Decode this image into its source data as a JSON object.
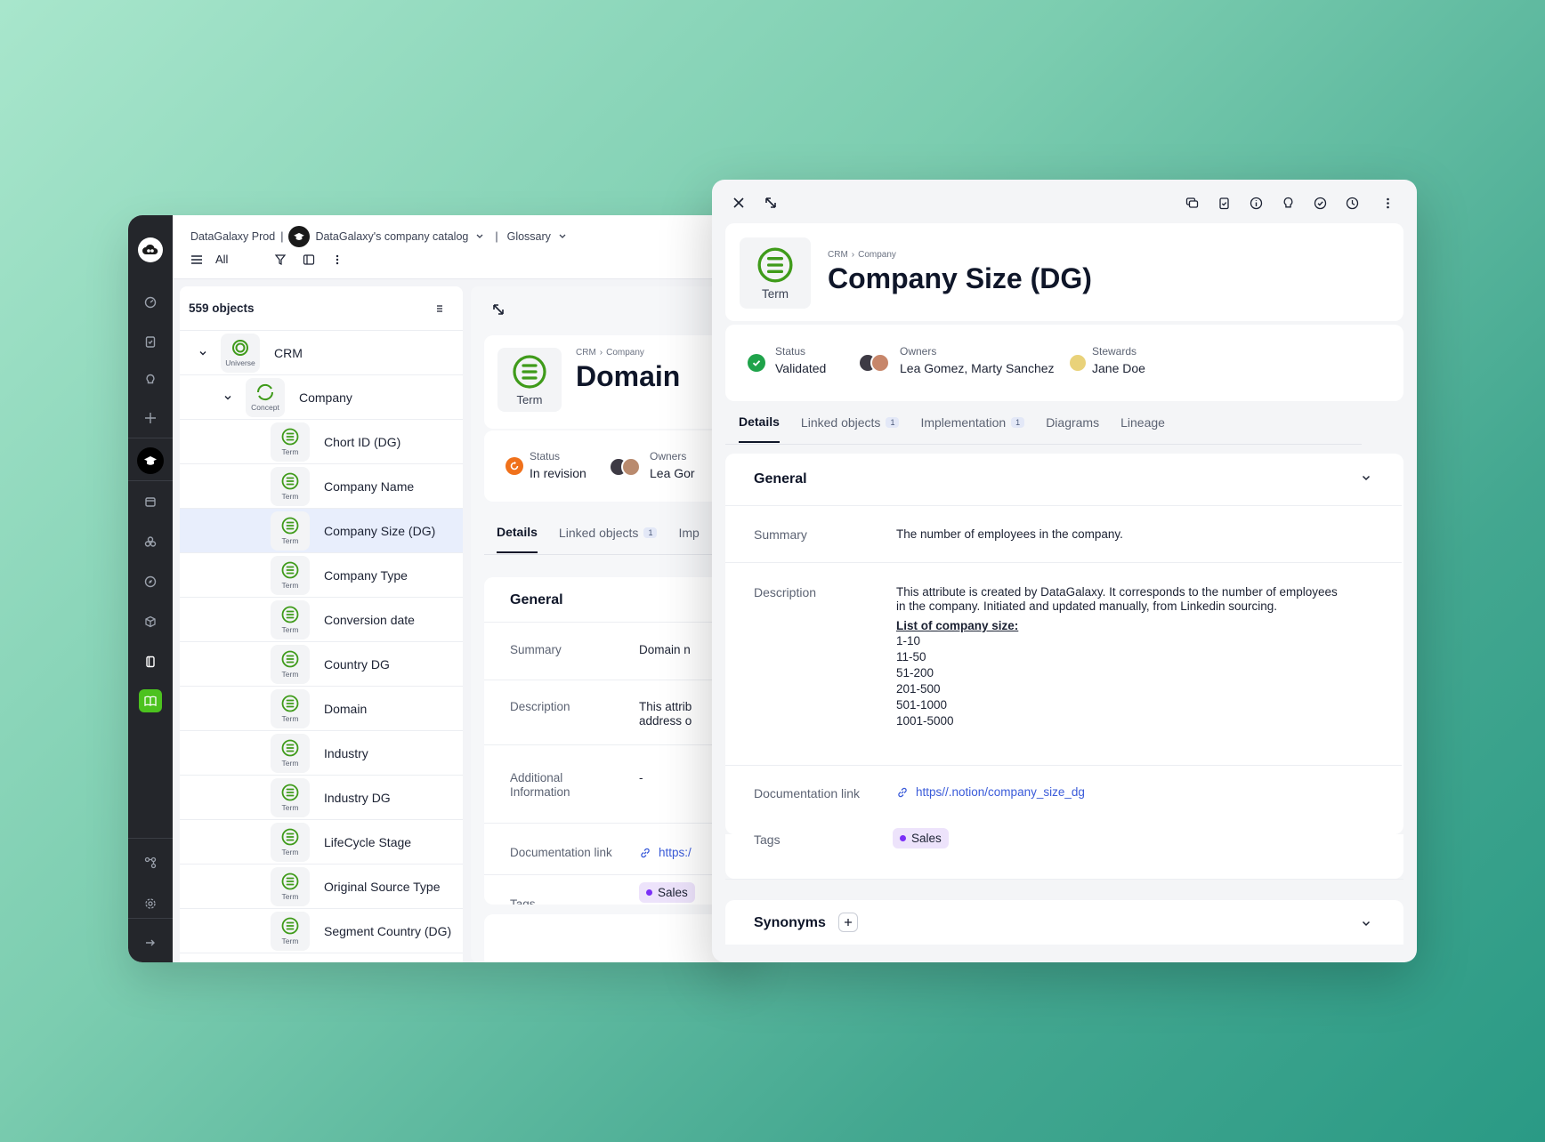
{
  "colors": {
    "accent_green": "#3f9b1a",
    "brand_dark": "#24262b",
    "link_blue": "#3a5bd9",
    "tag_purple": "#7b2ff7",
    "status_orange": "#f0711b",
    "status_green": "#1fa34a"
  },
  "back": {
    "topbar": {
      "workspace": "DataGalaxy Prod",
      "separator": "|",
      "catalog": "DataGalaxy's company catalog",
      "module": "Glossary",
      "filter_all": "All"
    },
    "list": {
      "count_label": "559 objects",
      "universe": {
        "label": "CRM",
        "type": "Universe"
      },
      "concept": {
        "label": "Company",
        "type": "Concept"
      },
      "term_caption": "Term",
      "terms": [
        "Chort ID (DG)",
        "Company Name",
        "Company Size (DG)",
        "Company Type",
        "Conversion date",
        "Country DG",
        "Domain",
        "Industry",
        "Industry DG",
        "LifeCycle Stage",
        "Original Source Type",
        "Segment Country (DG)"
      ]
    },
    "detail": {
      "crumb_1": "CRM",
      "crumb_2": "Company",
      "title": "Domain",
      "type": "Term",
      "status_label": "Status",
      "status_value": "In revision",
      "owners_label": "Owners",
      "owners_value": "Lea Gor",
      "tabs": [
        {
          "label": "Details",
          "count": ""
        },
        {
          "label": "Linked objects",
          "count": "1"
        },
        {
          "label": "Imp",
          "count": ""
        }
      ],
      "general": "General",
      "summary_label": "Summary",
      "summary_value": "Domain n",
      "description_label": "Description",
      "description_value_1": "This attrib",
      "description_value_2": "address o",
      "additional_label_1": "Additional",
      "additional_label_2": "Information",
      "additional_value": "-",
      "doc_label": "Documentation link",
      "doc_value": "https:/",
      "tags_label": "Tags",
      "tag": "Sales"
    }
  },
  "front": {
    "crumb_1": "CRM",
    "crumb_2": "Company",
    "title": "Company Size (DG)",
    "type": "Term",
    "status_label": "Status",
    "status_value": "Validated",
    "owners_label": "Owners",
    "owners_value": "Lea Gomez, Marty Sanchez",
    "stewards_label": "Stewards",
    "stewards_value": "Jane Doe",
    "tabs": [
      {
        "label": "Details",
        "count": ""
      },
      {
        "label": "Linked objects",
        "count": "1"
      },
      {
        "label": "Implementation",
        "count": "1"
      },
      {
        "label": "Diagrams",
        "count": ""
      },
      {
        "label": "Lineage",
        "count": ""
      }
    ],
    "general": {
      "title": "General",
      "summary_label": "Summary",
      "summary_value": "The number of employees in the company.",
      "description_label": "Description",
      "description_line_1": "This attribute is created by DataGalaxy. It corresponds to the number of employees",
      "description_line_2": "in the company. Initiated and updated manually, from Linkedin sourcing.",
      "list_title": "List of company size:",
      "sizes": [
        "1-10",
        "11-50",
        "51-200",
        "201-500",
        "501-1000",
        "1001-5000"
      ],
      "doc_label": "Documentation link",
      "doc_value": "https//.notion/company_size_dg",
      "tags_label": "Tags",
      "tag": "Sales"
    },
    "synonyms": {
      "title": "Synonyms"
    }
  },
  "icons": {
    "rail": [
      "logo-icon",
      "dashboard-icon",
      "clipboard-icon",
      "lightbulb-icon",
      "plus-icon",
      "glossary-icon",
      "catalog-icon",
      "usage-icon",
      "compass-icon",
      "cube-icon",
      "book-icon",
      "green-book-icon",
      "connector-icon",
      "settings-icon",
      "expand-arrow-icon"
    ],
    "toolbar": [
      "close-icon",
      "expand-icon",
      "comment-icon",
      "task-icon",
      "info-icon",
      "suggestion-icon",
      "check-icon",
      "history-icon",
      "more-icon"
    ]
  }
}
